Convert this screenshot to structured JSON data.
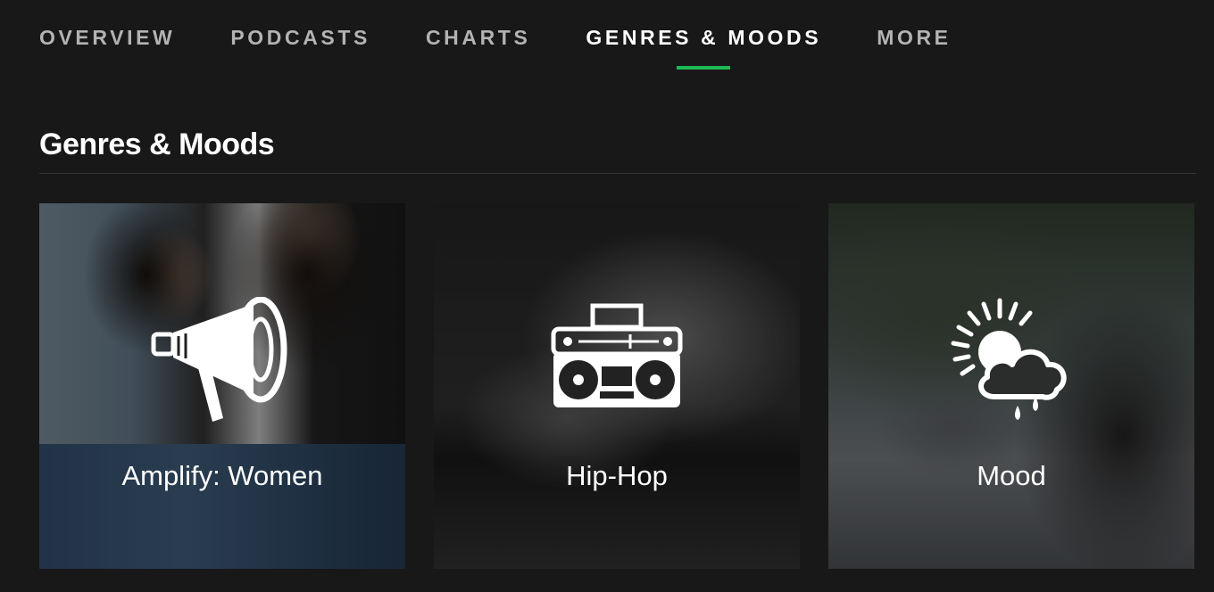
{
  "nav": {
    "tabs": [
      {
        "label": "OVERVIEW",
        "active": false
      },
      {
        "label": "PODCASTS",
        "active": false
      },
      {
        "label": "CHARTS",
        "active": false
      },
      {
        "label": "GENRES & MOODS",
        "active": true
      },
      {
        "label": "MORE",
        "active": false
      }
    ],
    "accent_color": "#1db954"
  },
  "section": {
    "title": "Genres & Moods"
  },
  "cards": [
    {
      "label": "Amplify: Women",
      "icon": "megaphone-icon"
    },
    {
      "label": "Hip-Hop",
      "icon": "boombox-icon"
    },
    {
      "label": "Mood",
      "icon": "sun-cloud-rain-icon"
    }
  ],
  "colors": {
    "background": "#181818",
    "text": "#ffffff",
    "muted_text": "#b3b3b3"
  }
}
